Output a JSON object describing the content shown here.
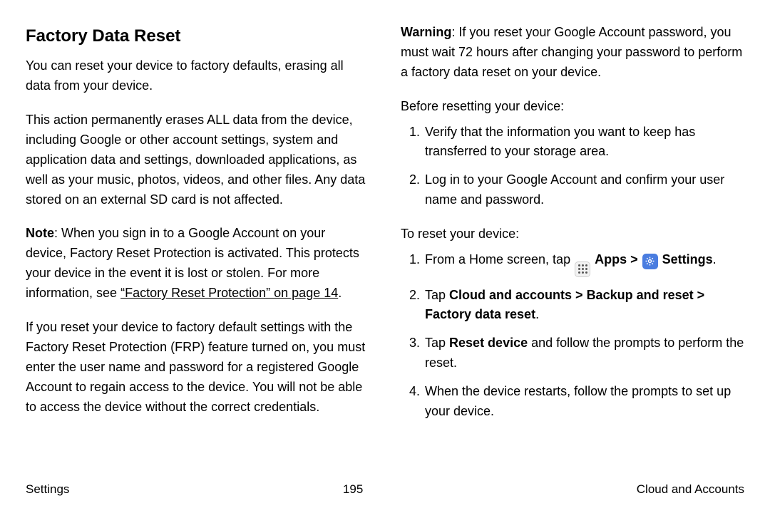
{
  "left": {
    "heading": "Factory Data Reset",
    "p1": "You can reset your device to factory defaults, erasing all data from your device.",
    "p2": "This action permanently erases ALL data from the device, including Google or other account settings, system and application data and settings, downloaded applications, as well as your music, photos, videos, and other files. Any data stored on an external SD card is not affected.",
    "note_label": "Note",
    "note_body_a": ": When you sign in to a Google Account on your device, Factory Reset Protection is activated. This protects your device in the event it is lost or stolen. For more information, see ",
    "note_link": "“Factory Reset Protection” on page 14",
    "note_body_b": ".",
    "p4": "If you reset your device to factory default settings with the Factory Reset Protection (FRP) feature turned on, you must enter the user name and password for a registered Google Account to regain access to the device. You will not be able to access the device without the correct credentials."
  },
  "right": {
    "warn_label": "Warning",
    "warn_body": ": If you reset your Google Account password, you must wait 72 hours after changing your password to perform a factory data reset on your device.",
    "before_intro": "Before resetting your device:",
    "before_items": [
      "Verify that the information you want to keep has transferred to your storage area.",
      "Log in to your Google Account and confirm your user name and password."
    ],
    "to_reset_intro": "To reset your device:",
    "step1_a": "From a Home screen, tap ",
    "step1_apps": "Apps",
    "step1_sep": " > ",
    "step1_settings": "Settings",
    "step1_end": ".",
    "step2_a": "Tap ",
    "step2_b1": "Cloud and accounts",
    "step2_sep1": " > ",
    "step2_b2": "Backup and reset",
    "step2_sep2": " > ",
    "step2_b3": "Factory data reset",
    "step2_end": ".",
    "step3_a": "Tap ",
    "step3_b": "Reset device",
    "step3_c": " and follow the prompts to perform the reset.",
    "step4": "When the device restarts, follow the prompts to set up your device."
  },
  "footer": {
    "left": "Settings",
    "center": "195",
    "right": "Cloud and Accounts"
  }
}
